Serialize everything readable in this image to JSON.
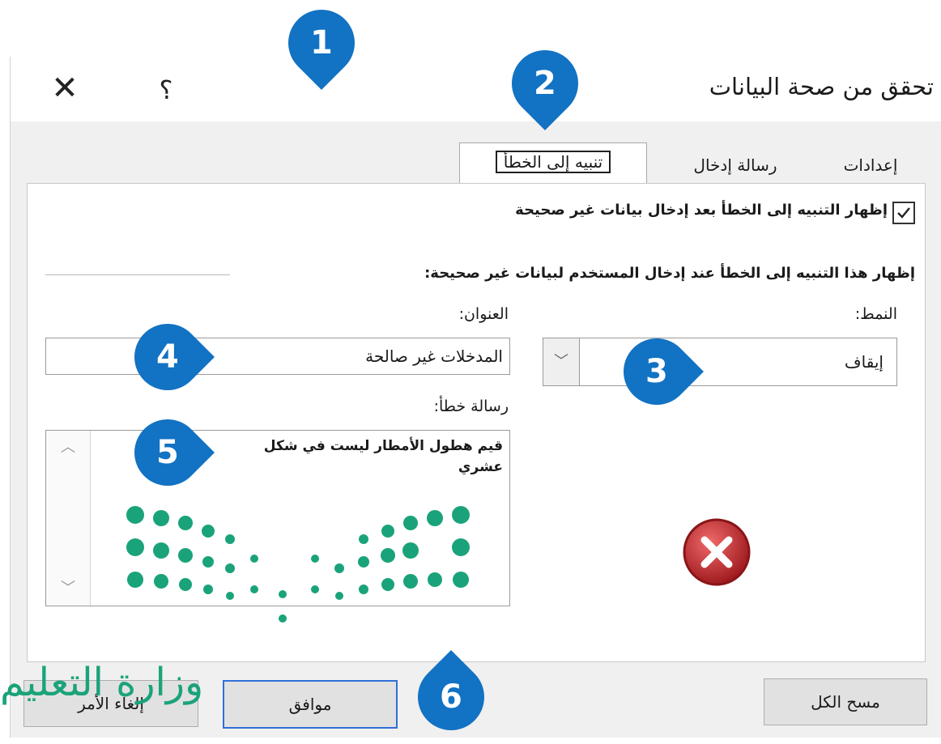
{
  "dialog": {
    "title": "تحقق من صحة البيانات",
    "close_symbol": "✕",
    "help_symbol": "؟"
  },
  "tabs": [
    {
      "label": "إعدادات",
      "active": false
    },
    {
      "label": "رسالة إدخال",
      "active": false
    },
    {
      "label": "تنبيه إلى الخطأ",
      "active": true
    }
  ],
  "error_alert": {
    "show_checkbox_label": "إظهار التنبيه إلى الخطأ بعد إدخال بيانات غير صحيحة",
    "show_checked": true,
    "section_label": "إظهار هذا التنبيه إلى الخطأ عند إدخال المستخدم لبيانات غير صحيحة:",
    "style_label": "النمط:",
    "style_value": "إيقاف",
    "title_label": "العنوان:",
    "title_value": "المدخلات غير صالحة",
    "message_label": "رسالة خطأ:",
    "message_value": "قيم هطول الأمطار ليست في شكل عشري",
    "style_icon": "stop-error-icon"
  },
  "buttons": {
    "clear_all": "مسح الكل",
    "ok": "موافق",
    "cancel": "إلغاء الأمر"
  },
  "markers": [
    "1",
    "2",
    "3",
    "4",
    "5",
    "6"
  ],
  "watermark": {
    "text": "وزارة التعليم",
    "color": "#1aa37a"
  },
  "colors": {
    "marker": "#1272c3",
    "default_button_border": "#2f6fd6",
    "stop_icon": "#c0282c"
  }
}
